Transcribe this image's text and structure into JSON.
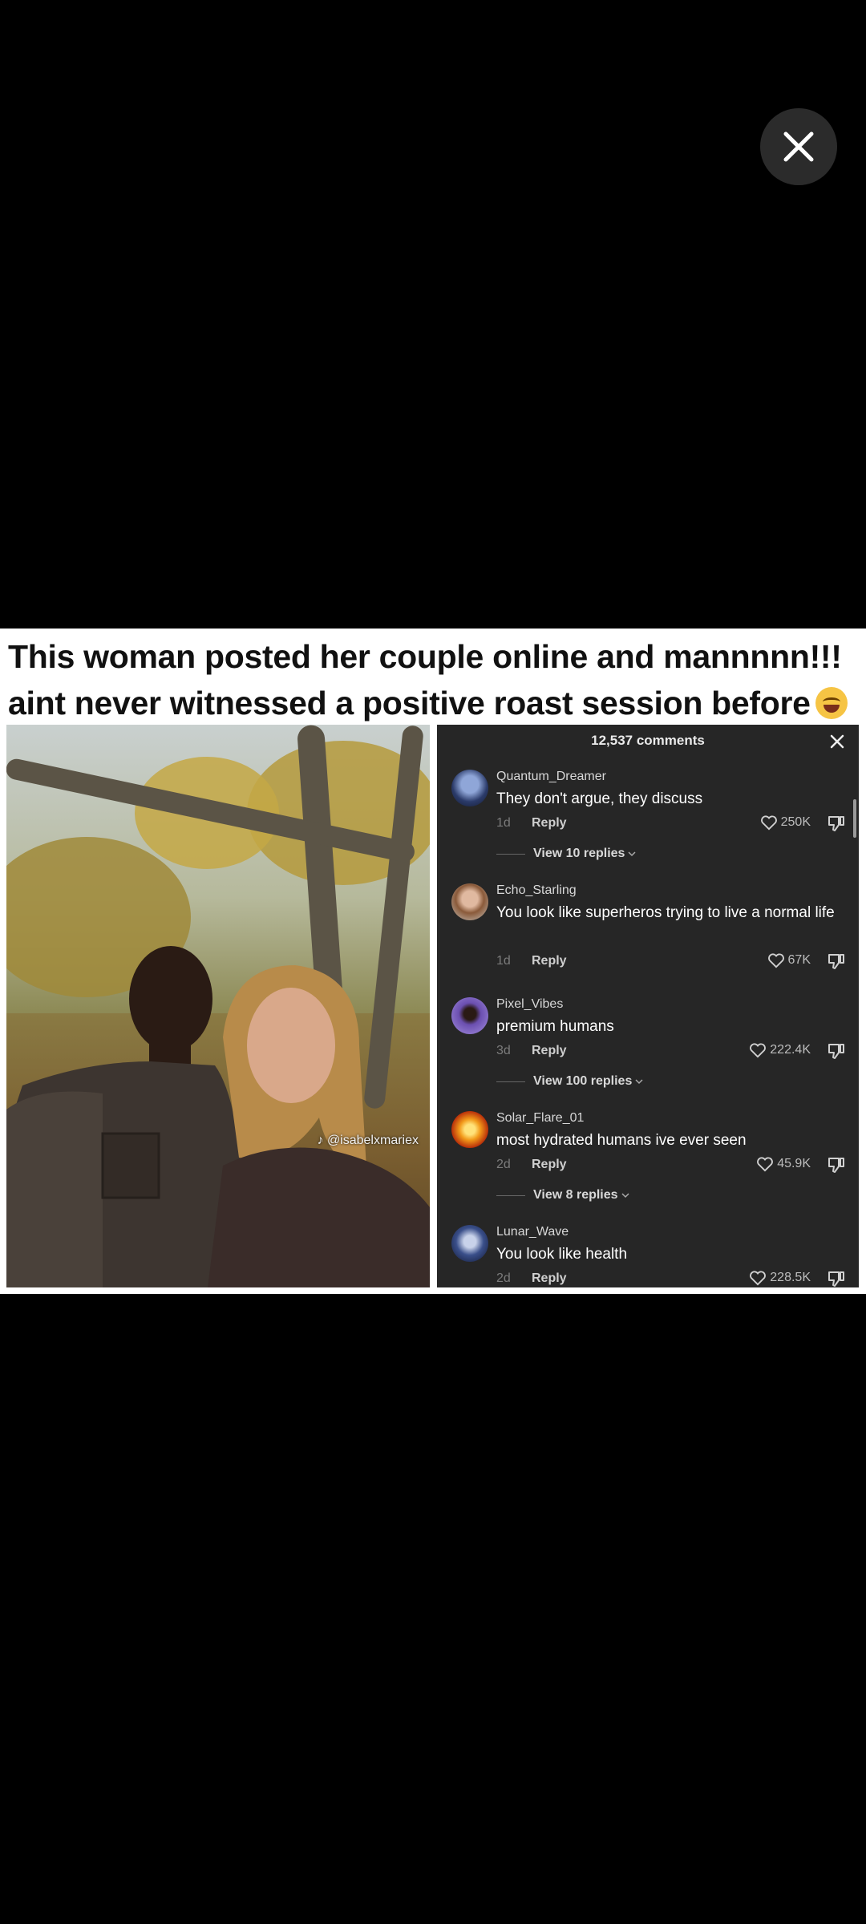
{
  "caption": {
    "line1": "This woman posted her couple online and mannnnn!!!",
    "line2": "aint never witnessed a positive roast session before"
  },
  "photo": {
    "watermark": "@isabelxmariex"
  },
  "comments_panel": {
    "title": "12,537 comments",
    "items": [
      {
        "username": "Quantum_Dreamer",
        "text": "They don't argue, they discuss",
        "age": "1d",
        "reply": "Reply",
        "likes": "250K",
        "view_replies": "View 10 replies"
      },
      {
        "username": "Echo_Starling",
        "text": "You look like superheros trying to live a normal life",
        "age": "1d",
        "reply": "Reply",
        "likes": "67K"
      },
      {
        "username": "Pixel_Vibes",
        "text": "premium humans",
        "age": "3d",
        "reply": "Reply",
        "likes": "222.4K",
        "view_replies": "View 100 replies"
      },
      {
        "username": "Solar_Flare_01",
        "text": "most hydrated humans ive ever seen",
        "age": "2d",
        "reply": "Reply",
        "likes": "45.9K",
        "view_replies": "View 8 replies"
      },
      {
        "username": "Lunar_Wave",
        "text": "You look like health",
        "age": "2d",
        "reply": "Reply",
        "likes": "228.5K"
      }
    ]
  },
  "icons": {
    "close": "close-icon",
    "heart": "heart-icon",
    "dislike": "dislike-icon",
    "chevron": "chevron-down-icon"
  },
  "colors": {
    "background": "#000000",
    "panel": "#262626",
    "overlay_button": "#2b2b2b"
  }
}
